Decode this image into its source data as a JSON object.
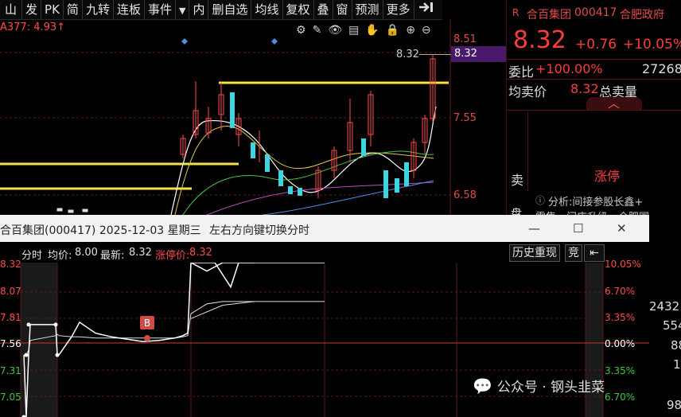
{
  "toolbar": {
    "items": [
      "山",
      "发",
      "PK",
      "简",
      "九转",
      "连板",
      "事件",
      "内",
      "删自选",
      "均线",
      "复权",
      "叠",
      "窗",
      "预测",
      "更多"
    ],
    "expand_icon": "exit-arrow-icon"
  },
  "indicator": {
    "text": "A377: 4.93↑"
  },
  "chart": {
    "price_label_current": "8.32",
    "price_axis": [
      "8.51",
      "8.32",
      "7.55",
      "6.58"
    ],
    "current_price_marker": "8.32"
  },
  "stock": {
    "flag": "R",
    "name": "合百集团",
    "code": "000417",
    "region": "合肥政府",
    "price": "8.32",
    "change": "+0.76",
    "change_pct": "+10.05%",
    "weibi_label": "委比",
    "weibi_value": "+100.00%",
    "weibi_extra": "27268",
    "avg_label": "均卖价",
    "avg_value": "8.32",
    "total_label": "总卖量",
    "sell_label": "卖",
    "limit_up_text": "涨停",
    "analysis_text": "分析:间接参股长鑫+",
    "extra_text": "零售、门店升级、合肥国"
  },
  "popup": {
    "title": "合百集团(000417) 2025-12-03 星期三",
    "hint": "左右方向键切换分时",
    "info": {
      "mode": "分时",
      "avg_label": "均价:",
      "avg_value": "8.00",
      "latest_label": "最新:",
      "latest_value": "8.32",
      "limit_label": "涨停价:",
      "limit_value": "8.32"
    },
    "history_button": "历史重现",
    "bid_button": "竞",
    "left_axis": [
      "8.32",
      "8.07",
      "7.81",
      "7.56",
      "7.31",
      "7.05"
    ],
    "right_axis": [
      "10.05%",
      "6.70%",
      "3.35%",
      "0.00%",
      "3.35%",
      "6.70%"
    ],
    "buy_marker": "B"
  },
  "behind_numbers": [
    "2432",
    "554",
    "88",
    "1",
    "98"
  ],
  "watermark": {
    "label": "公众号 · 钢头韭菜"
  },
  "colors": {
    "accent_red": "#ff3b3b",
    "yellow_line": "#f5e04a",
    "bg": "#000000"
  },
  "intraday": {
    "price_series": [
      7.56,
      7.05,
      7.56,
      7.81,
      7.81,
      7.56,
      7.56,
      7.71,
      7.83,
      7.74,
      7.71,
      7.69,
      7.67,
      7.68,
      7.7,
      7.72,
      7.74,
      8.32,
      8.25,
      8.32,
      8.32,
      8.32
    ],
    "avg_series": [
      7.56,
      7.56,
      7.6,
      7.68,
      7.72,
      7.73,
      7.72,
      7.71,
      7.71,
      7.7,
      7.7,
      7.7,
      7.7,
      7.7,
      7.7,
      7.71,
      7.72,
      7.9,
      7.98,
      8.0,
      8.0,
      8.0
    ]
  }
}
